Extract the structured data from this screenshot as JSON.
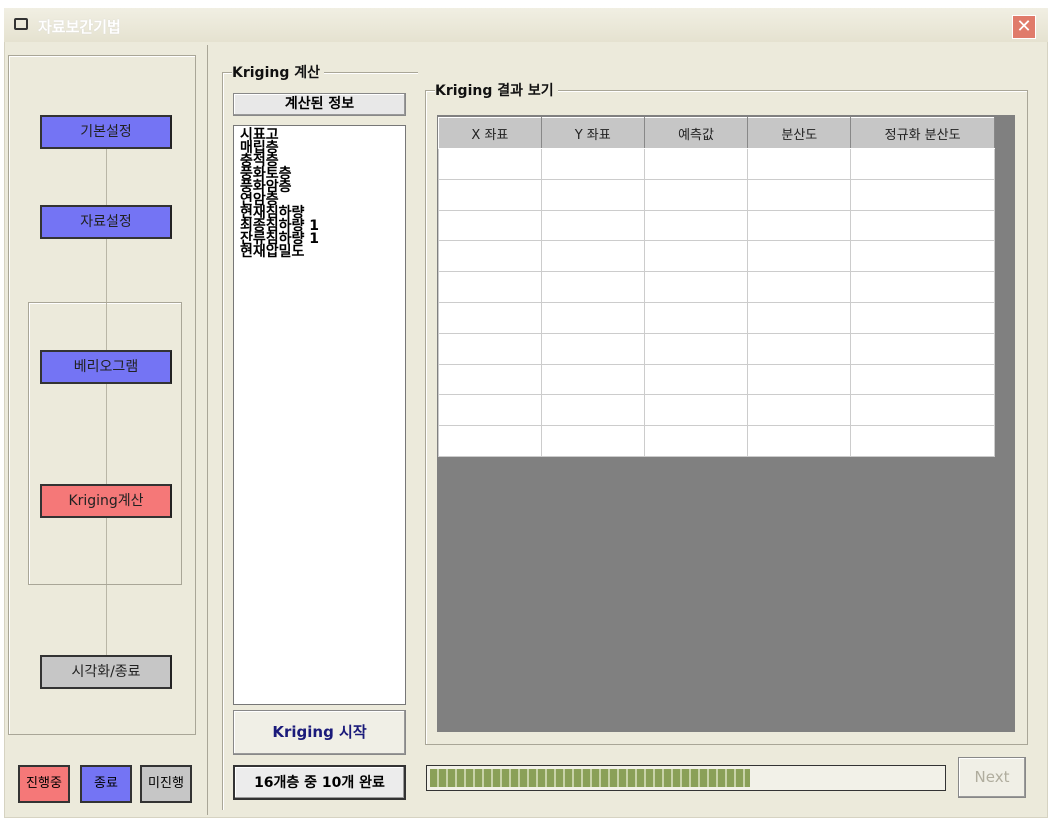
{
  "window": {
    "title": "자료보간기법",
    "close_icon": "close-icon"
  },
  "steps": [
    {
      "label": "기본설정",
      "state": "done"
    },
    {
      "label": "자료설정",
      "state": "done"
    },
    {
      "label": "베리오그램",
      "state": "done"
    },
    {
      "label": "Kriging계산",
      "state": "in-progress"
    },
    {
      "label": "시각화/종료",
      "state": "pending"
    }
  ],
  "legend": [
    {
      "label": "진행중",
      "color": "#f57878"
    },
    {
      "label": "종료",
      "color": "#7474f4"
    },
    {
      "label": "미진행",
      "color": "#c6c6c6"
    }
  ],
  "kriging_calc": {
    "title": "Kriging 계산",
    "info_header": "계산된 정보",
    "items": [
      "시표고",
      "매립층",
      "충적층",
      "풍화토층",
      "풍화암층",
      "연암층",
      "현재침하량",
      "최종침하량 1",
      "잔류침하량 1",
      "현재압밀도"
    ],
    "start_button": "Kriging 시작",
    "status": "16개층 중 10개 완료"
  },
  "results": {
    "title": "Kriging 결과 보기",
    "columns": [
      "X 좌표",
      "Y 좌표",
      "예측값",
      "분산도",
      "정규화 분산도"
    ],
    "row_count": 10
  },
  "progress": {
    "percent": 62.5
  },
  "next_button": "Next"
}
